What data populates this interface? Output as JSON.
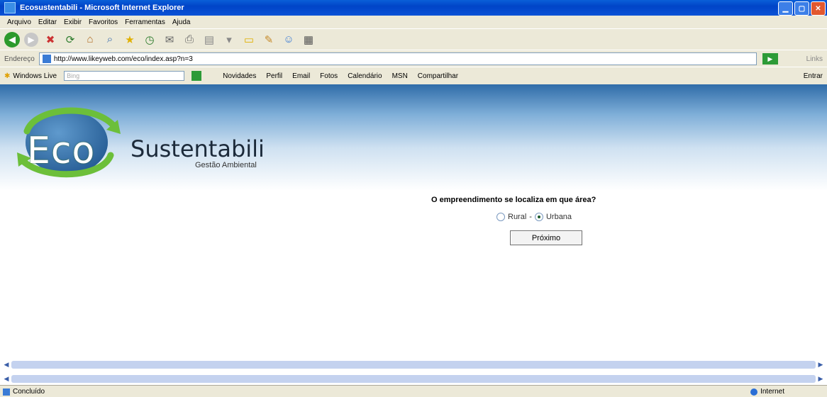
{
  "window": {
    "title": "Ecosustentabili - Microsoft Internet Explorer",
    "controls": [
      "minimize-icon",
      "maximize-icon",
      "close-icon"
    ]
  },
  "menu": [
    "Arquivo",
    "Editar",
    "Exibir",
    "Favoritos",
    "Ferramentas",
    "Ajuda"
  ],
  "toolbar": {
    "icons": [
      "back-icon",
      "forward-icon",
      "stop-icon",
      "refresh-icon",
      "home-icon",
      "search-icon",
      "favorites-icon",
      "history-icon",
      "mail-icon",
      "print-icon",
      "edit-icon",
      "discuss-icon",
      "folder-icon",
      "research-icon",
      "messenger-icon",
      "media-icon"
    ]
  },
  "address": {
    "label": "Endereço",
    "url": "http://www.likeyweb.com/eco/index.asp?n=3",
    "links_label": "Links"
  },
  "live": {
    "label": "Windows Live",
    "search_placeholder": "Bing",
    "items": [
      "Novidades",
      "Perfil",
      "Email",
      "Fotos",
      "Calendário",
      "MSN",
      "Compartilhar"
    ],
    "entrar": "Entrar"
  },
  "page": {
    "logo_eco": "Eco",
    "logo_name": "Sustentabili",
    "logo_tagline": "Gestão Ambiental",
    "question": "O empreendimento se localiza em que área?",
    "option_rural": "Rural",
    "separator": "-",
    "option_urbana": "Urbana",
    "selected": "Urbana",
    "next_button": "Próximo"
  },
  "status": {
    "text": "Concluído",
    "zone": "Internet"
  },
  "colors": {
    "title_bar": "#0054E3",
    "chrome": "#ECE9D8",
    "banner_top": "#2f6ca8",
    "scroll": "#c4d2ef"
  }
}
